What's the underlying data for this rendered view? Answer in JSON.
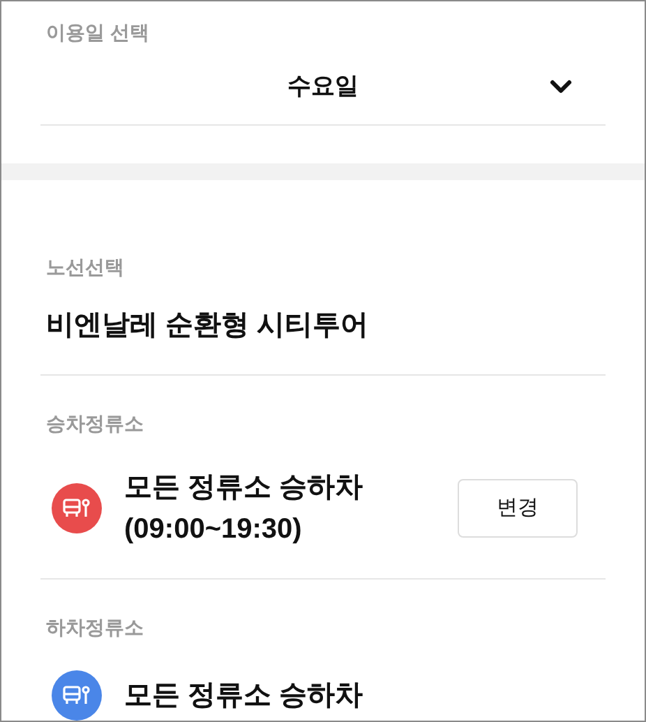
{
  "date_select": {
    "label": "이용일 선택",
    "value": "수요일"
  },
  "route": {
    "label": "노선선택",
    "value": "비엔날레 순환형 시티투어"
  },
  "stops": [
    {
      "label": "승차정류소",
      "name": "모든 정류소 승하차",
      "time": "(09:00~19:30)",
      "color": "#e84c4c",
      "button": "변경"
    },
    {
      "label": "하차정류소",
      "name": "모든 정류소 승하차",
      "color": "#4a86e8"
    }
  ]
}
